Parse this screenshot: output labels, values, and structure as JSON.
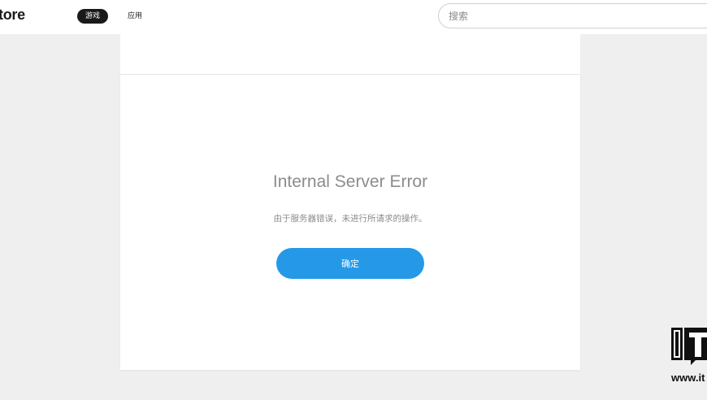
{
  "header": {
    "logo_text": "tore",
    "tabs": [
      {
        "label": "游戏",
        "active": true
      },
      {
        "label": "应用",
        "active": false
      }
    ],
    "search": {
      "placeholder": "搜索",
      "value": ""
    }
  },
  "error_dialog": {
    "title": "Internal Server Error",
    "message": "由于服务器错误，未进行所请求的操作。",
    "confirm_label": "确定"
  },
  "watermark": {
    "logo_icon": "ithome-logo-icon",
    "text": "www.it"
  },
  "colors": {
    "background": "#efefef",
    "accent_button": "#2599e8",
    "active_tab": "#1a1a1a",
    "muted_text": "#8c8c8c"
  }
}
